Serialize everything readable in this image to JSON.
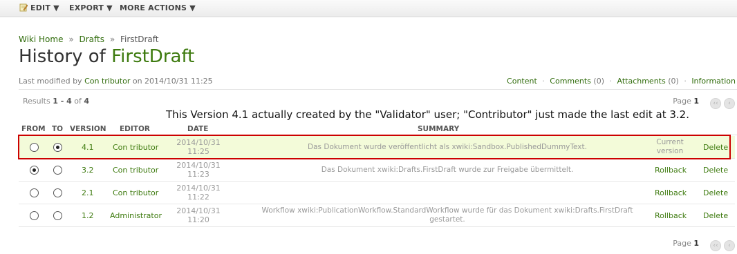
{
  "toolbar": {
    "edit": "EDIT ▼",
    "export": "EXPORT ▼",
    "more_actions": "MORE ACTIONS ▼"
  },
  "breadcrumb": {
    "home": "Wiki Home",
    "sep": "»",
    "drafts": "Drafts",
    "current": "FirstDraft"
  },
  "title": {
    "prefix": "History of",
    "doc": "FirstDraft"
  },
  "lastmod": {
    "prefix": "Last modified by",
    "user": "Con tributor",
    "on": "on 2014/10/31 11:25"
  },
  "doc_tabs": {
    "content": "Content",
    "comments": "Comments",
    "comments_count": "(0)",
    "attachments": "Attachments",
    "attachments_count": "(0)",
    "information": "Information",
    "sep": "·"
  },
  "results": {
    "label": "Results",
    "range": "1 - 4",
    "of": "of",
    "total": "4"
  },
  "pager": {
    "label": "Page",
    "page": "1"
  },
  "annotation": "This Version 4.1 actually created by the \"Validator\" user; \"Contributor\" just made the last edit at 3.2.",
  "columns": {
    "from": "FROM",
    "to": "TO",
    "version": "VERSION",
    "editor": "EDITOR",
    "date": "DATE",
    "summary": "SUMMARY"
  },
  "rows": [
    {
      "from_selected": false,
      "to_selected": true,
      "version": "4.1",
      "editor": "Con tributor",
      "date_line1": "2014/10/31",
      "date_line2": "11:25",
      "summary_line1": "Das Dokument wurde veröffentlicht als xwiki:Sandbox.PublishedDummyText.",
      "summary_line2": "",
      "action1": "Current",
      "action1b": "version",
      "delete": "Delete"
    },
    {
      "from_selected": true,
      "to_selected": false,
      "version": "3.2",
      "editor": "Con tributor",
      "date_line1": "2014/10/31",
      "date_line2": "11:23",
      "summary_line1": "Das Dokument xwiki:Drafts.FirstDraft wurde zur Freigabe übermittelt.",
      "summary_line2": "",
      "action1": "Rollback",
      "delete": "Delete"
    },
    {
      "from_selected": false,
      "to_selected": false,
      "version": "2.1",
      "editor": "Con tributor",
      "date_line1": "2014/10/31",
      "date_line2": "11:22",
      "summary_line1": "",
      "summary_line2": "",
      "action1": "Rollback",
      "delete": "Delete"
    },
    {
      "from_selected": false,
      "to_selected": false,
      "version": "1.2",
      "editor": "Administrator",
      "date_line1": "2014/10/31",
      "date_line2": "11:20",
      "summary_line1": "Workflow xwiki:PublicationWorkflow.StandardWorkflow wurde für das Dokument xwiki:Drafts.FirstDraft",
      "summary_line2": "gestartet.",
      "action1": "Rollback",
      "delete": "Delete"
    }
  ],
  "colors": {
    "link": "#3d7a0e",
    "current_row_bg": "#f3fbd9",
    "highlight_border": "#cc0000"
  }
}
